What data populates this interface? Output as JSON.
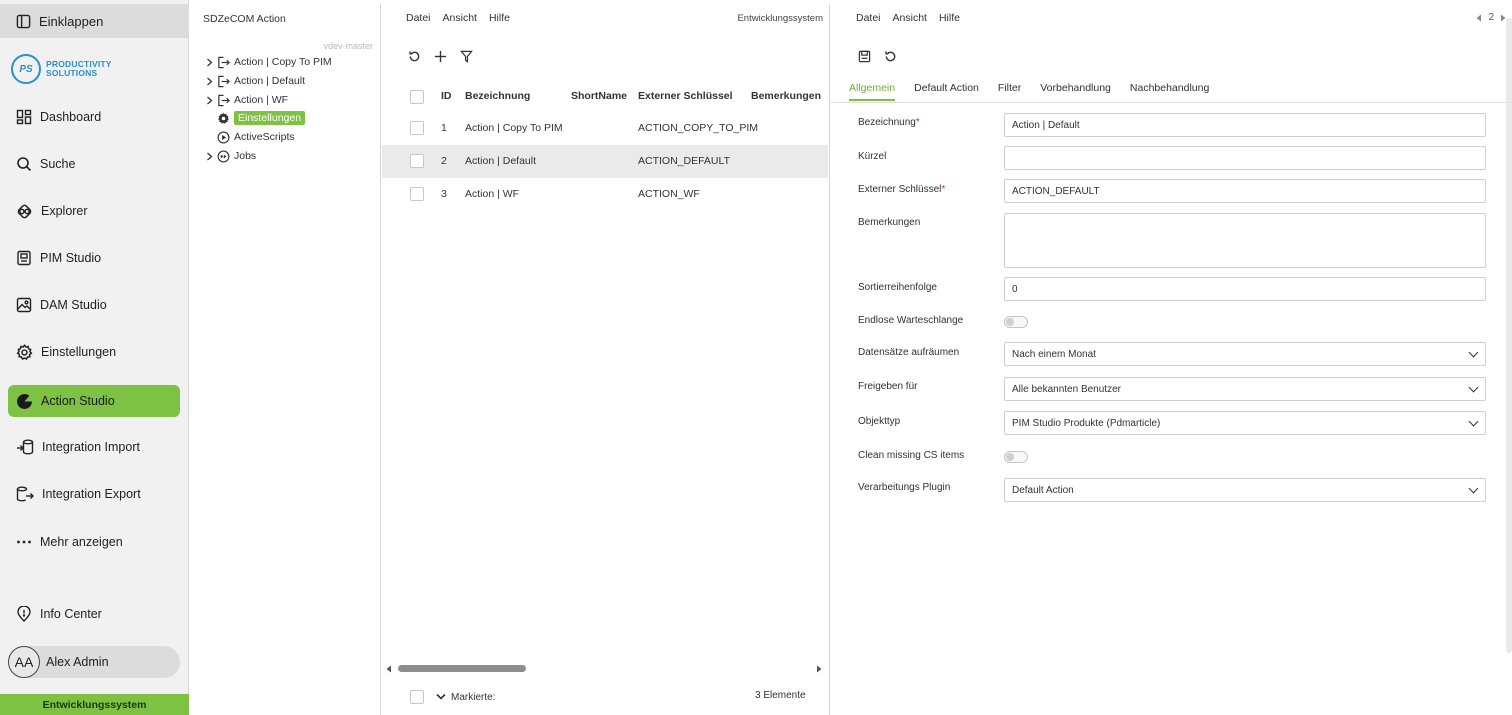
{
  "nav": {
    "collapse_label": "Einklappen",
    "logo_mark": "PS",
    "logo_line1": "PRODUCTIVITY",
    "logo_line2": "SOLUTIONS",
    "items": [
      {
        "label": "Dashboard",
        "icon": "dashboard-icon"
      },
      {
        "label": "Suche",
        "icon": "search-icon"
      },
      {
        "label": "Explorer",
        "icon": "explorer-icon"
      },
      {
        "label": "PIM Studio",
        "icon": "pim-icon"
      },
      {
        "label": "DAM Studio",
        "icon": "image-icon"
      },
      {
        "label": "Einstellungen",
        "icon": "gear-icon"
      },
      {
        "label": "Action Studio",
        "icon": "action-studio-icon",
        "active": true
      },
      {
        "label": "Integration Import",
        "icon": "import-icon"
      },
      {
        "label": "Integration Export",
        "icon": "export-icon"
      },
      {
        "label": "Mehr anzeigen",
        "icon": "more-icon"
      }
    ],
    "info_center": "Info Center",
    "user_initials": "AA",
    "user_name": "Alex Admin",
    "environment": "Entwicklungssystem",
    "accent_color": "#7dc243"
  },
  "tree": {
    "title": "SDZeCOM Action",
    "branch": "vdev-master",
    "items": [
      {
        "label": "Action | Copy To PIM",
        "expandable": true
      },
      {
        "label": "Action | Default",
        "expandable": true
      },
      {
        "label": "Action | WF",
        "expandable": true
      },
      {
        "label": "Einstellungen",
        "selected": true
      },
      {
        "label": "ActiveScripts"
      },
      {
        "label": "Jobs",
        "expandable": true
      }
    ]
  },
  "list": {
    "menu": [
      "Datei",
      "Ansicht",
      "Hilfe"
    ],
    "environment": "Entwicklungssystem",
    "columns": [
      "ID",
      "Bezeichnung",
      "ShortName",
      "Externer Schlüssel",
      "Bemerkungen"
    ],
    "rows": [
      {
        "id": "1",
        "name": "Action | Copy To PIM",
        "short": "",
        "key": "ACTION_COPY_TO_PIM",
        "notes": ""
      },
      {
        "id": "2",
        "name": "Action | Default",
        "short": "",
        "key": "ACTION_DEFAULT",
        "notes": "",
        "selected": true
      },
      {
        "id": "3",
        "name": "Action | WF",
        "short": "",
        "key": "ACTION_WF",
        "notes": ""
      }
    ],
    "footer_marked": "Markierte:",
    "footer_count": "3 Elemente"
  },
  "detail": {
    "menu": [
      "Datei",
      "Ansicht",
      "Hilfe"
    ],
    "pager": "2",
    "tabs": [
      "Allgemein",
      "Default Action",
      "Filter",
      "Vorbehandlung",
      "Nachbehandlung"
    ],
    "active_tab": "Allgemein",
    "fields": {
      "bezeichnung": {
        "label": "Bezeichnung",
        "required": "*",
        "value": "Action | Default"
      },
      "kuerzel": {
        "label": "Kürzel",
        "value": ""
      },
      "externer_schluessel": {
        "label": "Externer Schlüssel",
        "required": "*",
        "value": "ACTION_DEFAULT"
      },
      "bemerkungen": {
        "label": "Bemerkungen",
        "value": ""
      },
      "sortierreihenfolge": {
        "label": "Sortierreihenfolge",
        "value": "0"
      },
      "endlose_warteschlange": {
        "label": "Endlose Warteschlange",
        "checked": false
      },
      "datensaetze_aufraeumen": {
        "label": "Datensätze aufräumen",
        "value": "Nach einem Monat"
      },
      "freigeben_fuer": {
        "label": "Freigeben für",
        "value": "Alle bekannten Benutzer"
      },
      "objekttyp": {
        "label": "Objekttyp",
        "value": "PIM Studio Produkte (Pdmarticle)"
      },
      "clean_missing": {
        "label": "Clean missing CS items",
        "checked": false
      },
      "verarbeitungs_plugin": {
        "label": "Verarbeitungs Plugin",
        "value": "Default Action"
      }
    }
  }
}
